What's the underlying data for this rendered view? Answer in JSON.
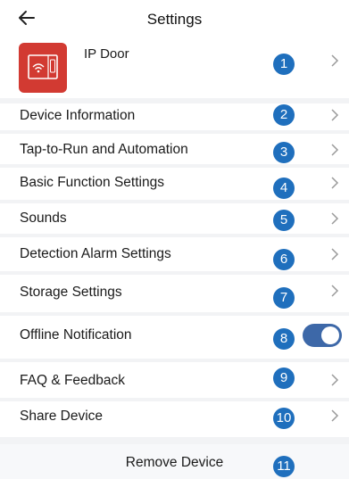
{
  "header": {
    "title": "Settings",
    "back_icon": "arrow-left-icon"
  },
  "device": {
    "name": "IP Door",
    "logo_icon": "intercom-panel-icon",
    "logo_color": "#d23a32",
    "badge": "1"
  },
  "menu": {
    "device_information": {
      "label": "Device Information",
      "badge": "2"
    },
    "tap_to_run": {
      "label": "Tap-to-Run and Automation",
      "badge": "3"
    },
    "basic_function": {
      "label": "Basic Function Settings",
      "badge": "4"
    },
    "sounds": {
      "label": "Sounds",
      "badge": "5"
    },
    "detection_alarm": {
      "label": "Detection Alarm Settings",
      "badge": "6"
    },
    "storage": {
      "label": "Storage Settings",
      "badge": "7"
    },
    "offline_notification": {
      "label": "Offline Notification",
      "badge": "8",
      "toggle_on": true
    },
    "faq_feedback": {
      "label": "FAQ & Feedback",
      "badge": "9"
    },
    "share_device": {
      "label": "Share Device",
      "badge": "10"
    }
  },
  "remove": {
    "label": "Remove Device",
    "badge": "11"
  },
  "colors": {
    "badge": "#1f6fbd",
    "toggle_on": "#3d68a8",
    "divider": "#f2f3f5"
  }
}
